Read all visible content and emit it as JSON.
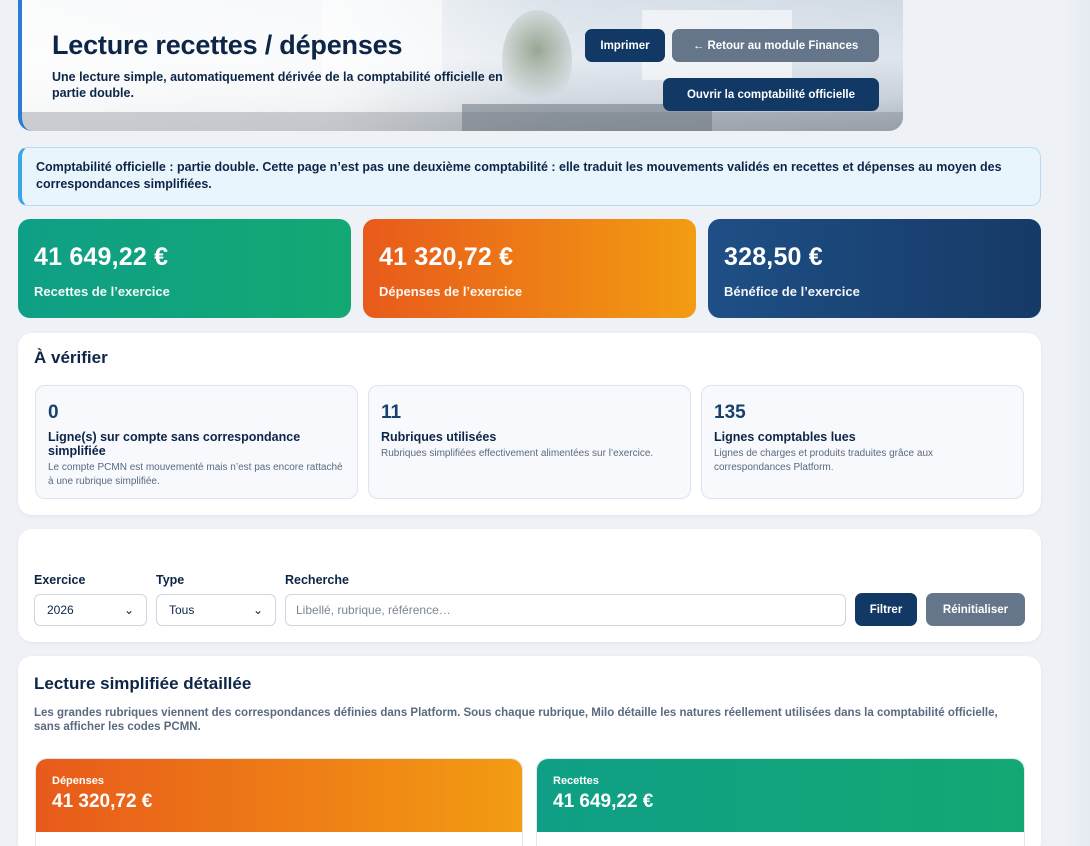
{
  "header": {
    "title": "Lecture recettes / dépenses",
    "subtitle": "Une lecture simple, automatiquement dérivée de la comptabilité officielle en partie double.",
    "print_label": "Imprimer",
    "back_label": "← Retour au module Finances",
    "open_accounting_label": "Ouvrir la comptabilité officielle"
  },
  "info_banner": "Comptabilité officielle : partie double. Cette page n’est pas une deuxième comptabilité : elle traduit les mouvements validés en recettes et dépenses au moyen des correspondances simplifiées.",
  "kpis": [
    {
      "value": "41 649,22 €",
      "label": "Recettes de l’exercice",
      "gradient": [
        "#0f9f86",
        "#13a873"
      ]
    },
    {
      "value": "41 320,72 €",
      "label": "Dépenses de l’exercice",
      "gradient": [
        "#e85a1b",
        "#f39c12"
      ]
    },
    {
      "value": "328,50 €",
      "label": "Bénéfice de l’exercice",
      "gradient": [
        "#1e4f86",
        "#163a66"
      ]
    }
  ],
  "verify": {
    "title": "À vérifier",
    "items": [
      {
        "number": "0",
        "title": "Ligne(s) sur compte sans correspondance simplifiée",
        "description": "Le compte PCMN est mouvementé mais n’est pas encore rattaché à une rubrique simplifiée."
      },
      {
        "number": "11",
        "title": "Rubriques utilisées",
        "description": "Rubriques simplifiées effectivement alimentées sur l’exercice."
      },
      {
        "number": "135",
        "title": "Lignes comptables lues",
        "description": "Lignes de charges et produits traduites grâce aux correspondances Platform."
      }
    ]
  },
  "filters": {
    "exercise_label": "Exercice",
    "exercise_value": "2026",
    "type_label": "Type",
    "type_value": "Tous",
    "search_label": "Recherche",
    "search_placeholder": "Libellé, rubrique, référence…",
    "filter_label": "Filtrer",
    "reset_label": "Réinitialiser"
  },
  "detail": {
    "title": "Lecture simplifiée détaillée",
    "description": "Les grandes rubriques viennent des correspondances définies dans Platform. Sous chaque rubrique, Milo détaille les natures réellement utilisées dans la comptabilité officielle, sans afficher les codes PCMN.",
    "expenses": {
      "label": "Dépenses",
      "value": "41 320,72 €"
    },
    "income": {
      "label": "Recettes",
      "value": "41 649,22 €"
    }
  },
  "colors": {
    "navy": "#123866",
    "slate": "#65758a",
    "info_border": "#3aa6e6"
  }
}
